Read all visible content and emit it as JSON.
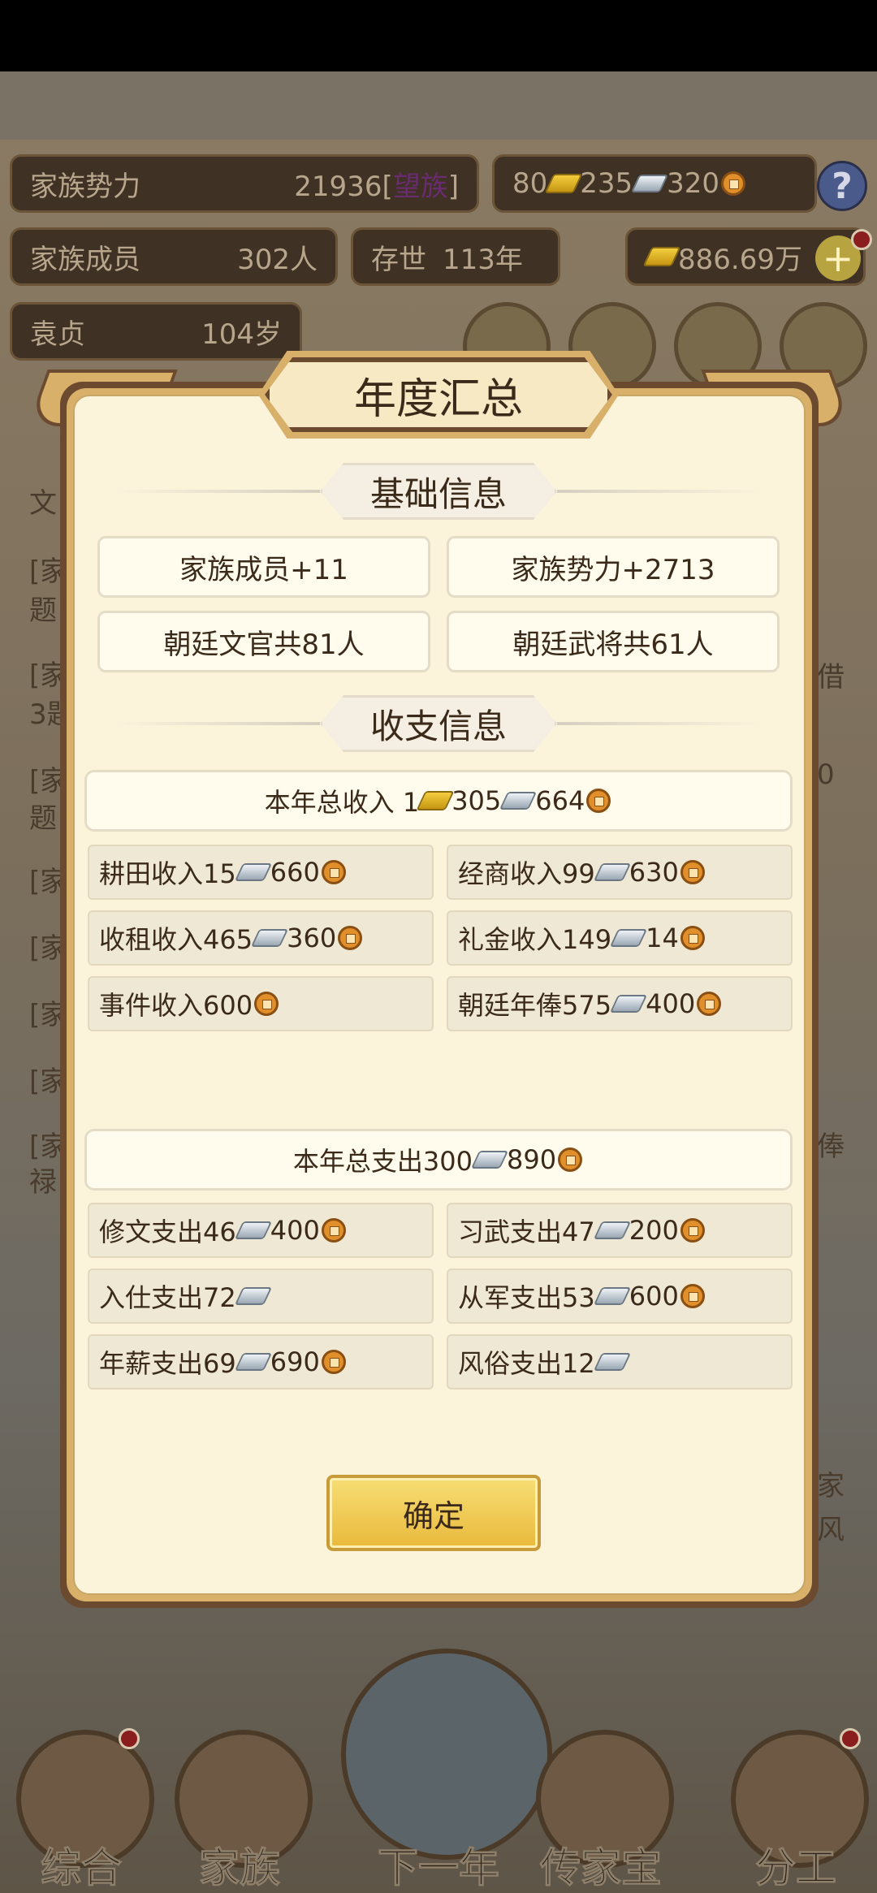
{
  "background": {
    "clan_power_label": "家族势力",
    "clan_power_value": "21936",
    "clan_power_rank_open": "[",
    "clan_power_rank": "望族",
    "clan_power_rank_close": "]",
    "gold": "80",
    "silver": "235",
    "copper": "320",
    "members_label": "家族成员",
    "members_value": "302人",
    "existence_label": "存世",
    "existence_value": "113年",
    "wealth": "886.69万",
    "person_name": "袁贞",
    "person_age": "104岁",
    "left_lines": [
      "文",
      "[家",
      "题",
      "[家",
      "3题",
      "[家",
      "题",
      "[家",
      "[家",
      "[家",
      "[家",
      "[家",
      "禄"
    ],
    "right_chars": [
      "借",
      "0",
      "俸",
      "家",
      "风"
    ]
  },
  "modal": {
    "title": "年度汇总",
    "basic_section": "基础信息",
    "basic_items": [
      "家族成员+11",
      "家族势力+2713",
      "朝廷文官共81人",
      "朝廷武将共61人"
    ],
    "income_section": "收支信息",
    "income_total": {
      "label": "本年总收入 1",
      "gold": "305",
      "silver": "664"
    },
    "income_items": [
      {
        "label": "耕田收入15",
        "a": "660"
      },
      {
        "label": "经商收入99",
        "a": "630"
      },
      {
        "label": "收租收入465",
        "a": "360"
      },
      {
        "label": "礼金收入149",
        "a": "14"
      },
      {
        "label": "事件收入600"
      },
      {
        "label": "朝廷年俸575",
        "a": "400"
      }
    ],
    "expense_total": {
      "label": "本年总支出300",
      "silver": "890"
    },
    "expense_items": [
      {
        "label": "修文支出46",
        "a": "400"
      },
      {
        "label": "习武支出47",
        "a": "200"
      },
      {
        "label": "入仕支出72"
      },
      {
        "label": "从军支出53",
        "a": "600"
      },
      {
        "label": "年薪支出69",
        "a": "690"
      },
      {
        "label": "风俗支出12"
      }
    ],
    "confirm": "确定"
  },
  "nav": [
    "综合",
    "家族",
    "下一年",
    "传家宝",
    "分工"
  ],
  "colors": {
    "gold": "#e9b93b",
    "frame": "#6b4a30",
    "panel": "#fbf3da"
  }
}
